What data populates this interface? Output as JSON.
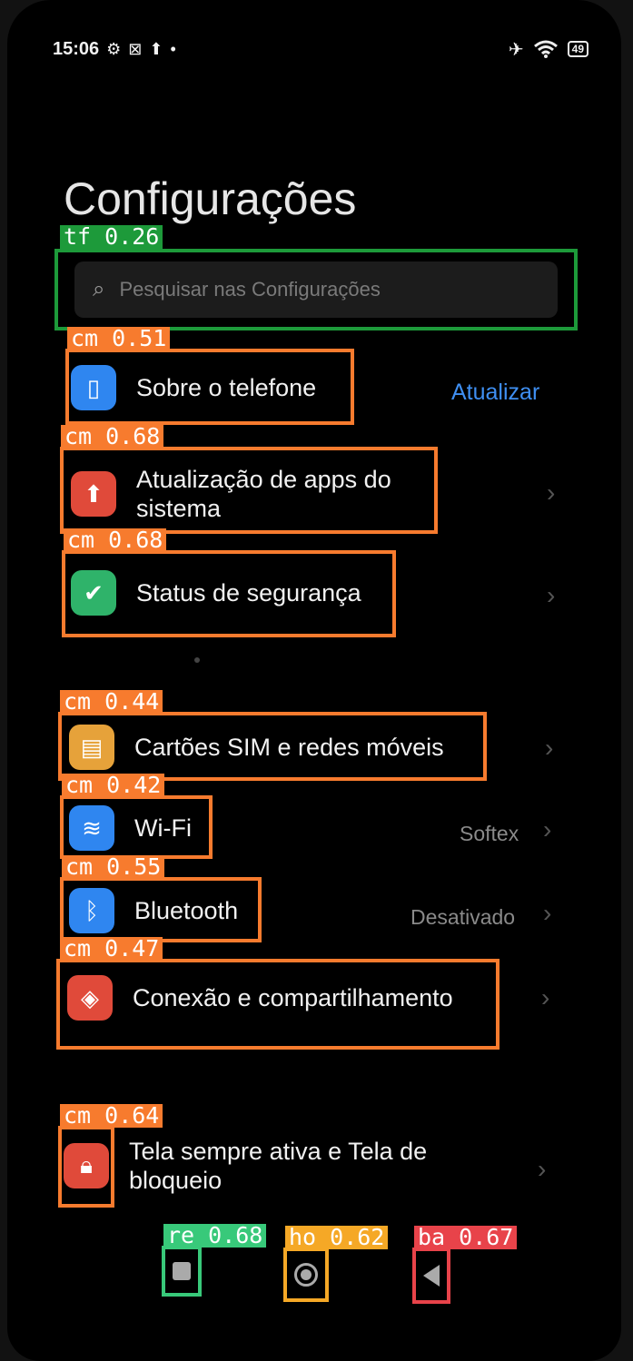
{
  "status_bar": {
    "time": "15:06",
    "battery": "49"
  },
  "page_title": "Configurações",
  "search": {
    "placeholder": "Pesquisar nas Configurações",
    "detector_tag": "tf 0.26"
  },
  "items": [
    {
      "label": "Sobre o telefone",
      "action": "Atualizar",
      "icon": "phone-icon",
      "icon_color": "#2f86f0",
      "tag": "cm 0.51"
    },
    {
      "label": "Atualização de apps do sistema",
      "icon": "arrow-up-icon",
      "icon_color": "#e04a3a",
      "tag": "cm 0.68"
    },
    {
      "label": "Status de segurança",
      "icon": "shield-icon",
      "icon_color": "#2fb36a",
      "tag": "cm 0.68"
    },
    {
      "label": "Cartões SIM e redes móveis",
      "icon": "sim-icon",
      "icon_color": "#e6a23a",
      "tag": "cm 0.44"
    },
    {
      "label": "Wi-Fi",
      "value": "Softex",
      "icon": "wifi-icon",
      "icon_color": "#2f86f0",
      "tag": "cm 0.42"
    },
    {
      "label": "Bluetooth",
      "value": "Desativado",
      "icon": "bluetooth-icon",
      "icon_color": "#2f86f0",
      "tag": "cm 0.55"
    },
    {
      "label": "Conexão e compartilhamento",
      "icon": "share-icon",
      "icon_color": "#e04a3a",
      "tag": "cm 0.47"
    },
    {
      "label": "Tela sempre ativa e Tela de bloqueio",
      "icon": "lock-icon",
      "icon_color": "#e04a3a",
      "tag": "cm 0.64"
    }
  ],
  "nav": {
    "recents_tag": "re 0.68",
    "home_tag": "ho 0.62",
    "back_tag": "ba 0.67"
  },
  "colors": {
    "accent": "#3f8ff2",
    "detector_cm": "#f77b2e",
    "detector_tf": "#1d9a3a"
  }
}
